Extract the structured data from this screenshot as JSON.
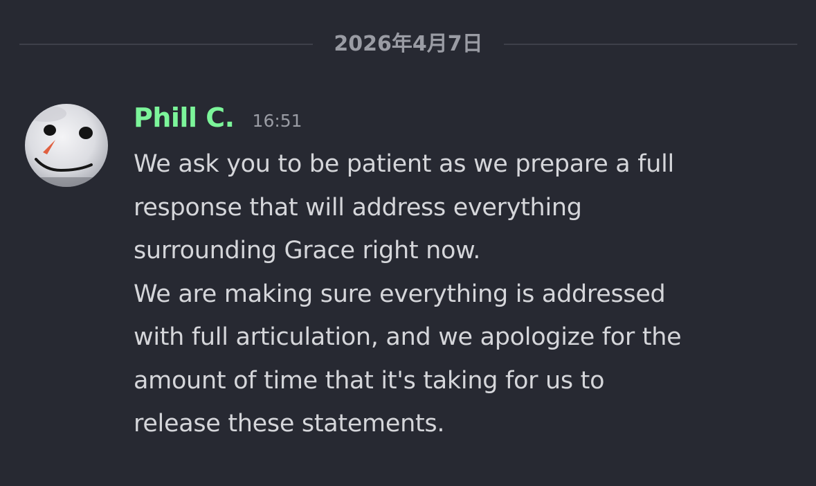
{
  "chat": {
    "date_divider": "2026年4月7日",
    "message": {
      "author": "Phill C.",
      "author_color": "#7cf59a",
      "time": "16:51",
      "avatar_icon": "snowman-face-avatar",
      "lines": [
        "We ask you to be patient as we prepare a full",
        "response that will address everything",
        "surrounding Grace right now.",
        "We are making sure everything is addressed",
        "with full articulation, and we apologize for the",
        "amount of time that it's taking for us to",
        "release these statements."
      ]
    }
  }
}
